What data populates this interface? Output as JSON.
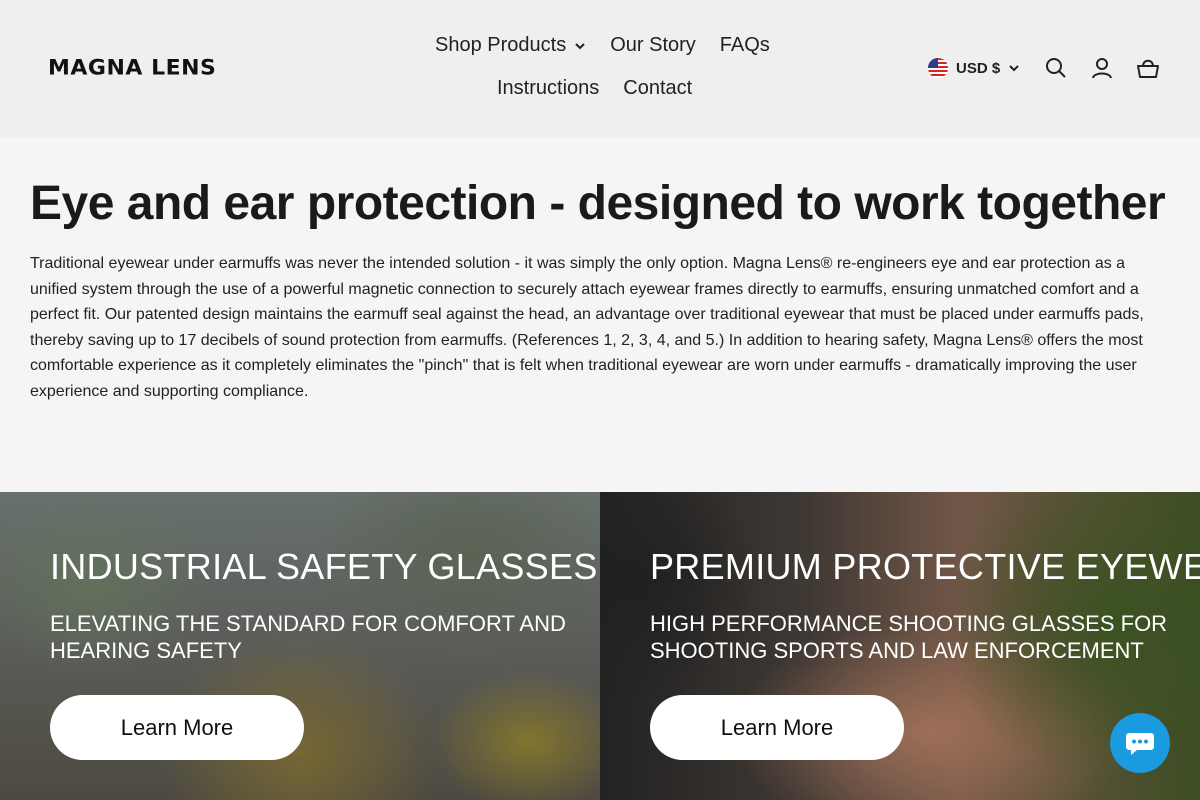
{
  "header": {
    "logo": "MAGNA LENS",
    "nav": [
      {
        "label": "Shop Products"
      },
      {
        "label": "Our Story"
      },
      {
        "label": "FAQs"
      },
      {
        "label": "Instructions"
      },
      {
        "label": "Contact"
      }
    ],
    "currency": "USD $",
    "icons": [
      "us-flag-icon",
      "chevron-down-icon",
      "search-icon",
      "account-icon",
      "cart-icon"
    ]
  },
  "intro": {
    "title": "Eye and ear protection - designed to work together",
    "body": "Traditional eyewear under earmuffs was never the intended solution - it was simply the only option. Magna Lens® re-engineers eye and ear protection as a unified system through the use of a powerful magnetic connection to securely attach eyewear frames directly to earmuffs, ensuring unmatched comfort and a perfect fit. Our patented design maintains the earmuff seal against the head, an advantage over traditional eyewear that must be placed under earmuffs pads, thereby saving up to 17 decibels of sound protection from earmuffs. (References 1, 2, 3, 4, and 5.) In addition to hearing safety, Magna Lens® offers the most comfortable experience as it completely eliminates the \"pinch\" that is felt when traditional eyewear are worn under earmuffs - dramatically improving the user experience and supporting compliance."
  },
  "cards": [
    {
      "title": "INDUSTRIAL SAFETY GLASSES",
      "subtitle": "ELEVATING THE STANDARD FOR COMFORT AND HEARING SAFETY",
      "button": "Learn More"
    },
    {
      "title": "PREMIUM PROTECTIVE EYEWEAR",
      "subtitle": "HIGH PERFORMANCE SHOOTING GLASSES FOR SHOOTING SPORTS AND LAW ENFORCEMENT",
      "button": "Learn More"
    }
  ],
  "chat": {
    "icon": "chat-icon",
    "color": "#1a9be0"
  }
}
